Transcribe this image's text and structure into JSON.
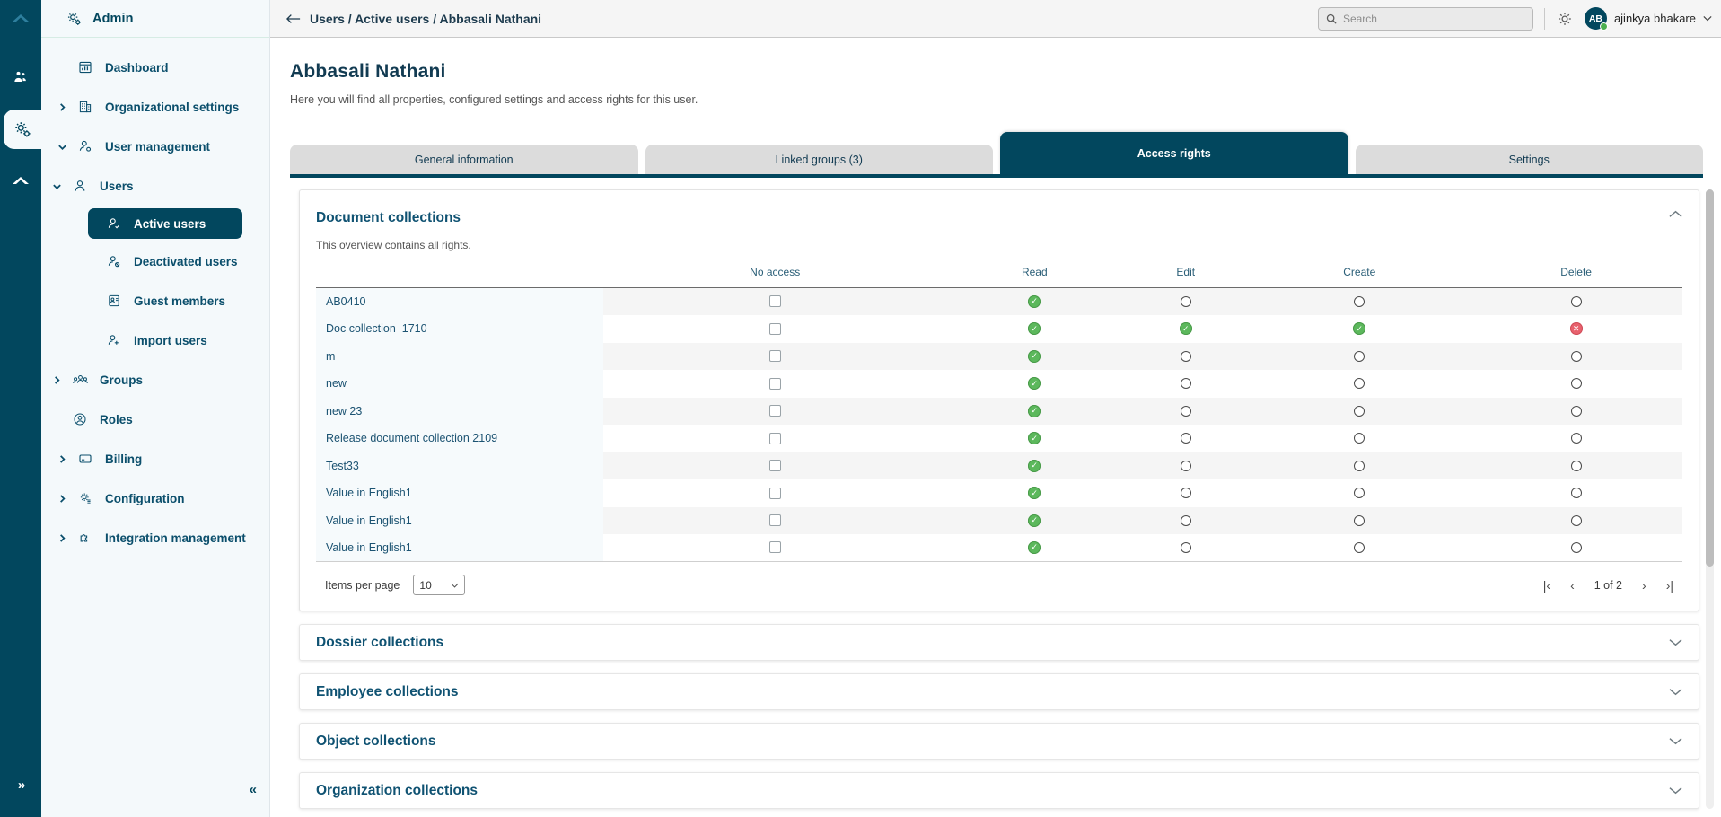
{
  "rail": {
    "logo_icon": "cloud-logo-icon",
    "items": [
      {
        "icon": "people-group-icon",
        "name": "rail-item-people",
        "active": false
      },
      {
        "icon": "gears-admin-icon",
        "name": "rail-item-admin",
        "active": true
      },
      {
        "icon": "cloud-icon",
        "name": "rail-item-cloud",
        "active": false
      }
    ],
    "expand_label": "»"
  },
  "sidebar": {
    "title": "Admin",
    "title_icon": "gears-admin-icon",
    "collapse_label": "«",
    "items": [
      {
        "label": "Dashboard",
        "icon": "dashboard-icon",
        "level": 0,
        "caret": "",
        "selected": false,
        "name": "sidebar-item-dashboard"
      },
      {
        "label": "Organizational settings",
        "icon": "building-icon",
        "level": 0,
        "caret": "right",
        "selected": false,
        "name": "sidebar-item-organizational-settings"
      },
      {
        "label": "User management",
        "icon": "user-cog-icon",
        "level": 0,
        "caret": "down",
        "selected": false,
        "name": "sidebar-item-user-management"
      },
      {
        "label": "Users",
        "icon": "user-icon",
        "level": 1,
        "caret": "down",
        "selected": false,
        "name": "sidebar-item-users"
      },
      {
        "label": "Active users",
        "icon": "user-check-icon",
        "level": 2,
        "caret": "",
        "selected": true,
        "name": "sidebar-item-active-users"
      },
      {
        "label": "Deactivated users",
        "icon": "user-block-icon",
        "level": 2,
        "caret": "",
        "selected": false,
        "name": "sidebar-item-deactivated-users"
      },
      {
        "label": "Guest members",
        "icon": "id-badge-icon",
        "level": 2,
        "caret": "",
        "selected": false,
        "name": "sidebar-item-guest-members"
      },
      {
        "label": "Import users",
        "icon": "user-plus-icon",
        "level": 2,
        "caret": "",
        "selected": false,
        "name": "sidebar-item-import-users"
      },
      {
        "label": "Groups",
        "icon": "users-group-icon",
        "level": 1,
        "caret": "right",
        "selected": false,
        "name": "sidebar-item-groups"
      },
      {
        "label": "Roles",
        "icon": "user-circle-icon",
        "level": 1,
        "caret": "",
        "selected": false,
        "name": "sidebar-item-roles"
      },
      {
        "label": "Billing",
        "icon": "credit-card-icon",
        "level": 0,
        "caret": "right",
        "selected": false,
        "name": "sidebar-item-billing"
      },
      {
        "label": "Configuration",
        "icon": "gear-list-icon",
        "level": 0,
        "caret": "right",
        "selected": false,
        "name": "sidebar-item-configuration"
      },
      {
        "label": "Integration management",
        "icon": "puzzle-icon",
        "level": 0,
        "caret": "right",
        "selected": false,
        "name": "sidebar-item-integration-management"
      }
    ]
  },
  "topbar": {
    "back_icon": "arrow-left-icon",
    "breadcrumb": "Users / Active users / Abbasali Nathani",
    "search": {
      "value": "",
      "placeholder": "Search",
      "icon": "search-icon"
    },
    "gear_icon": "gear-icon",
    "user": {
      "initials": "AB",
      "name": "ajinkya bhakare",
      "status": "online",
      "chevron": "⌄"
    }
  },
  "page": {
    "title": "Abbasali Nathani",
    "subtitle": "Here you will find all properties, configured settings and access rights for this user."
  },
  "tabs": [
    {
      "label": "General information",
      "active": false,
      "name": "tab-general-information"
    },
    {
      "label": "Linked groups (3)",
      "active": false,
      "name": "tab-linked-groups"
    },
    {
      "label": "Access rights",
      "active": true,
      "name": "tab-access-rights"
    },
    {
      "label": "Settings",
      "active": false,
      "name": "tab-settings"
    }
  ],
  "document_collections": {
    "title": "Document collections",
    "subtitle": "This overview contains all rights.",
    "chevron": "up",
    "columns": [
      "",
      "No access",
      "Read",
      "Edit",
      "Create",
      "Delete"
    ],
    "rows": [
      {
        "name": "AB0410",
        "no_access": "checkbox",
        "read": "yes",
        "edit": "radio",
        "create": "radio",
        "delete": "radio"
      },
      {
        "name": "Doc collection  1710",
        "no_access": "checkbox",
        "read": "yes",
        "edit": "yes",
        "create": "yes",
        "delete": "no"
      },
      {
        "name": "m",
        "no_access": "checkbox",
        "read": "yes",
        "edit": "radio",
        "create": "radio",
        "delete": "radio"
      },
      {
        "name": "new",
        "no_access": "checkbox",
        "read": "yes",
        "edit": "radio",
        "create": "radio",
        "delete": "radio"
      },
      {
        "name": "new 23",
        "no_access": "checkbox",
        "read": "yes",
        "edit": "radio",
        "create": "radio",
        "delete": "radio"
      },
      {
        "name": "Release document collection 2109",
        "no_access": "checkbox",
        "read": "yes",
        "edit": "radio",
        "create": "radio",
        "delete": "radio"
      },
      {
        "name": "Test33",
        "no_access": "checkbox",
        "read": "yes",
        "edit": "radio",
        "create": "radio",
        "delete": "radio"
      },
      {
        "name": "Value in English1",
        "no_access": "checkbox",
        "read": "yes",
        "edit": "radio",
        "create": "radio",
        "delete": "radio"
      },
      {
        "name": "Value in English1",
        "no_access": "checkbox",
        "read": "yes",
        "edit": "radio",
        "create": "radio",
        "delete": "radio"
      },
      {
        "name": "Value in English1",
        "no_access": "checkbox",
        "read": "yes",
        "edit": "radio",
        "create": "radio",
        "delete": "radio"
      }
    ],
    "pagination": {
      "items_per_page_label": "Items per page",
      "items_per_page_value": "10",
      "page_info": "1 of 2",
      "first_label": "|‹",
      "prev_label": "‹",
      "next_label": "›",
      "last_label": "›|"
    }
  },
  "accordions": [
    {
      "title": "Dossier collections",
      "name": "accordion-dossier-collections"
    },
    {
      "title": "Employee collections",
      "name": "accordion-employee-collections"
    },
    {
      "title": "Object collections",
      "name": "accordion-object-collections"
    },
    {
      "title": "Organization collections",
      "name": "accordion-organization-collections"
    }
  ],
  "colors": {
    "brand_dark": "#02475e",
    "sidebar_bg": "#f4f9fb",
    "accent_green": "#5cb85c",
    "accent_red": "#e8616d",
    "title_blue": "#0f5272"
  }
}
